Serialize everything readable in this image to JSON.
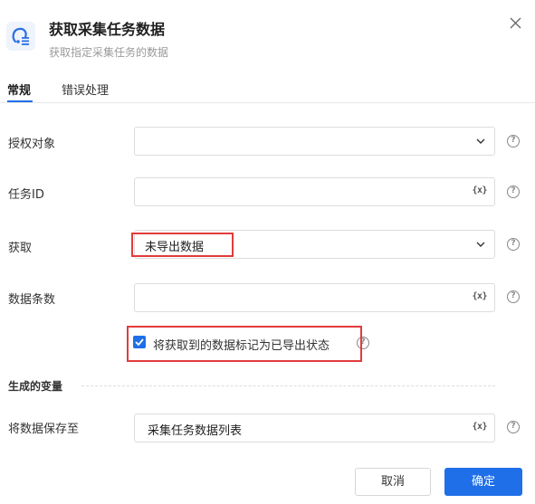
{
  "dialog": {
    "title": "获取采集任务数据",
    "subtitle": "获取指定采集任务的数据",
    "icon": "collect-data-icon"
  },
  "tabs": [
    {
      "label": "常规",
      "active": true
    },
    {
      "label": "错误处理",
      "active": false
    }
  ],
  "fields": {
    "auth": {
      "label": "授权对象",
      "value": ""
    },
    "task_id": {
      "label": "任务ID",
      "value": "",
      "var_label": "{x}"
    },
    "fetch": {
      "label": "获取",
      "value": "未导出数据"
    },
    "count": {
      "label": "数据条数",
      "value": "",
      "var_label": "{x}"
    }
  },
  "checkbox": {
    "label": "将获取到的数据标记为已导出状态",
    "checked": true
  },
  "section": {
    "title": "生成的变量"
  },
  "output": {
    "label": "将数据保存至",
    "value": "采集任务数据列表",
    "var_label": "{x}"
  },
  "help_glyph": "?",
  "buttons": {
    "cancel": "取消",
    "ok": "确定"
  },
  "colors": {
    "primary": "#1f6fe8",
    "highlight": "#e23b3b"
  }
}
